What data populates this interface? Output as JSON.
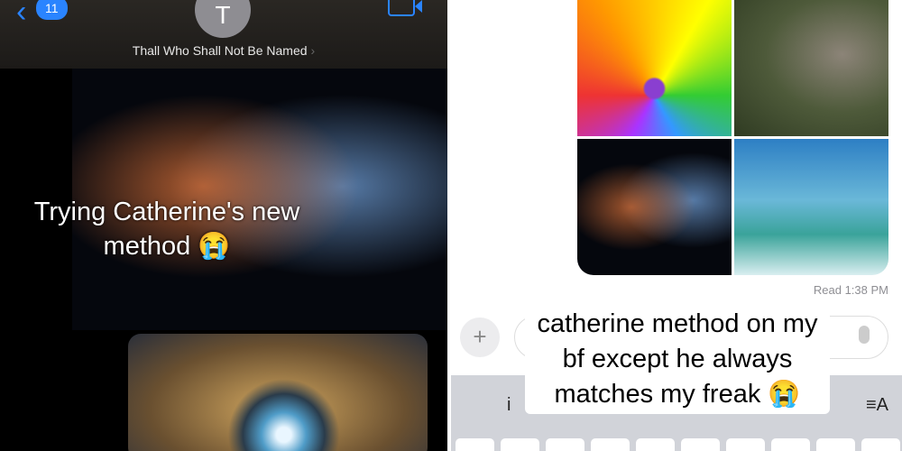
{
  "left": {
    "header": {
      "back_count": "11",
      "avatar_initial": "T",
      "contact_name": "Thall Who Shall Not Be Named",
      "chevron": "›"
    },
    "caption": "Trying Catherine's new method 😭"
  },
  "right": {
    "read_receipt": "Read 1:38 PM",
    "plus_label": "+",
    "keyboard": {
      "suggestion": "i",
      "format_label": "≡A"
    },
    "caption": "catherine method on my bf except he always matches my freak 😭"
  },
  "colors": {
    "ios_blue": "#2a84ff",
    "keyboard_bg": "#d1d3d9"
  }
}
